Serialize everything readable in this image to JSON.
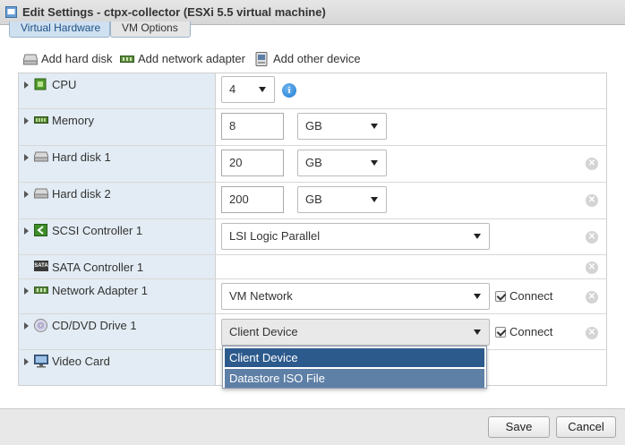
{
  "window": {
    "title": "Edit Settings - ctpx-collector (ESXi 5.5 virtual machine)"
  },
  "tabs": [
    {
      "label": "Virtual Hardware",
      "active": true
    },
    {
      "label": "VM Options",
      "active": false
    }
  ],
  "toolbar": {
    "add_hard_disk": "Add hard disk",
    "add_network_adapter": "Add network adapter",
    "add_other_device": "Add other device"
  },
  "devices": {
    "cpu": {
      "label": "CPU",
      "value": "4"
    },
    "memory": {
      "label": "Memory",
      "value": "8",
      "unit": "GB"
    },
    "hard_disk_1": {
      "label": "Hard disk 1",
      "value": "20",
      "unit": "GB"
    },
    "hard_disk_2": {
      "label": "Hard disk 2",
      "value": "200",
      "unit": "GB"
    },
    "scsi_controller_1": {
      "label": "SCSI Controller 1",
      "value": "LSI Logic Parallel"
    },
    "sata_controller_1": {
      "label": "SATA Controller 1",
      "icon_text": "SATA"
    },
    "network_adapter_1": {
      "label": "Network Adapter 1",
      "value": "VM Network",
      "connect_label": "Connect",
      "connected": true
    },
    "cd_dvd_drive_1": {
      "label": "CD/DVD Drive 1",
      "value": "Client Device",
      "connect_label": "Connect",
      "connected": true
    },
    "video_card": {
      "label": "Video Card"
    }
  },
  "cd_dropdown": {
    "options": [
      "Client Device",
      "Datastore ISO File"
    ],
    "selected": "Client Device"
  },
  "footer": {
    "save_label": "Save",
    "cancel_label": "Cancel"
  },
  "colors": {
    "label_column_bg": "#e3ecf4",
    "dropdown_selected": "#2c5a8c",
    "dropdown_option": "#5e7fa6",
    "tab_active_text": "#1d5187",
    "info_icon": "#1f7bd0"
  }
}
